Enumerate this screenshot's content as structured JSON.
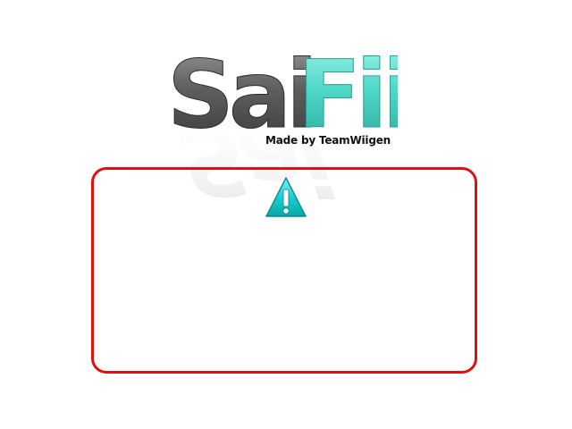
{
  "logo": {
    "part1": "Sai",
    "part2": "Fii",
    "color_part1": "#5a5a5a",
    "color_part2": "#4fd8c8"
  },
  "byline": "Made by TeamWiigen",
  "dialog": {
    "border_color": "#e01010",
    "icon": "warning-icon",
    "icon_color": "#1ad0d0",
    "message": ""
  }
}
